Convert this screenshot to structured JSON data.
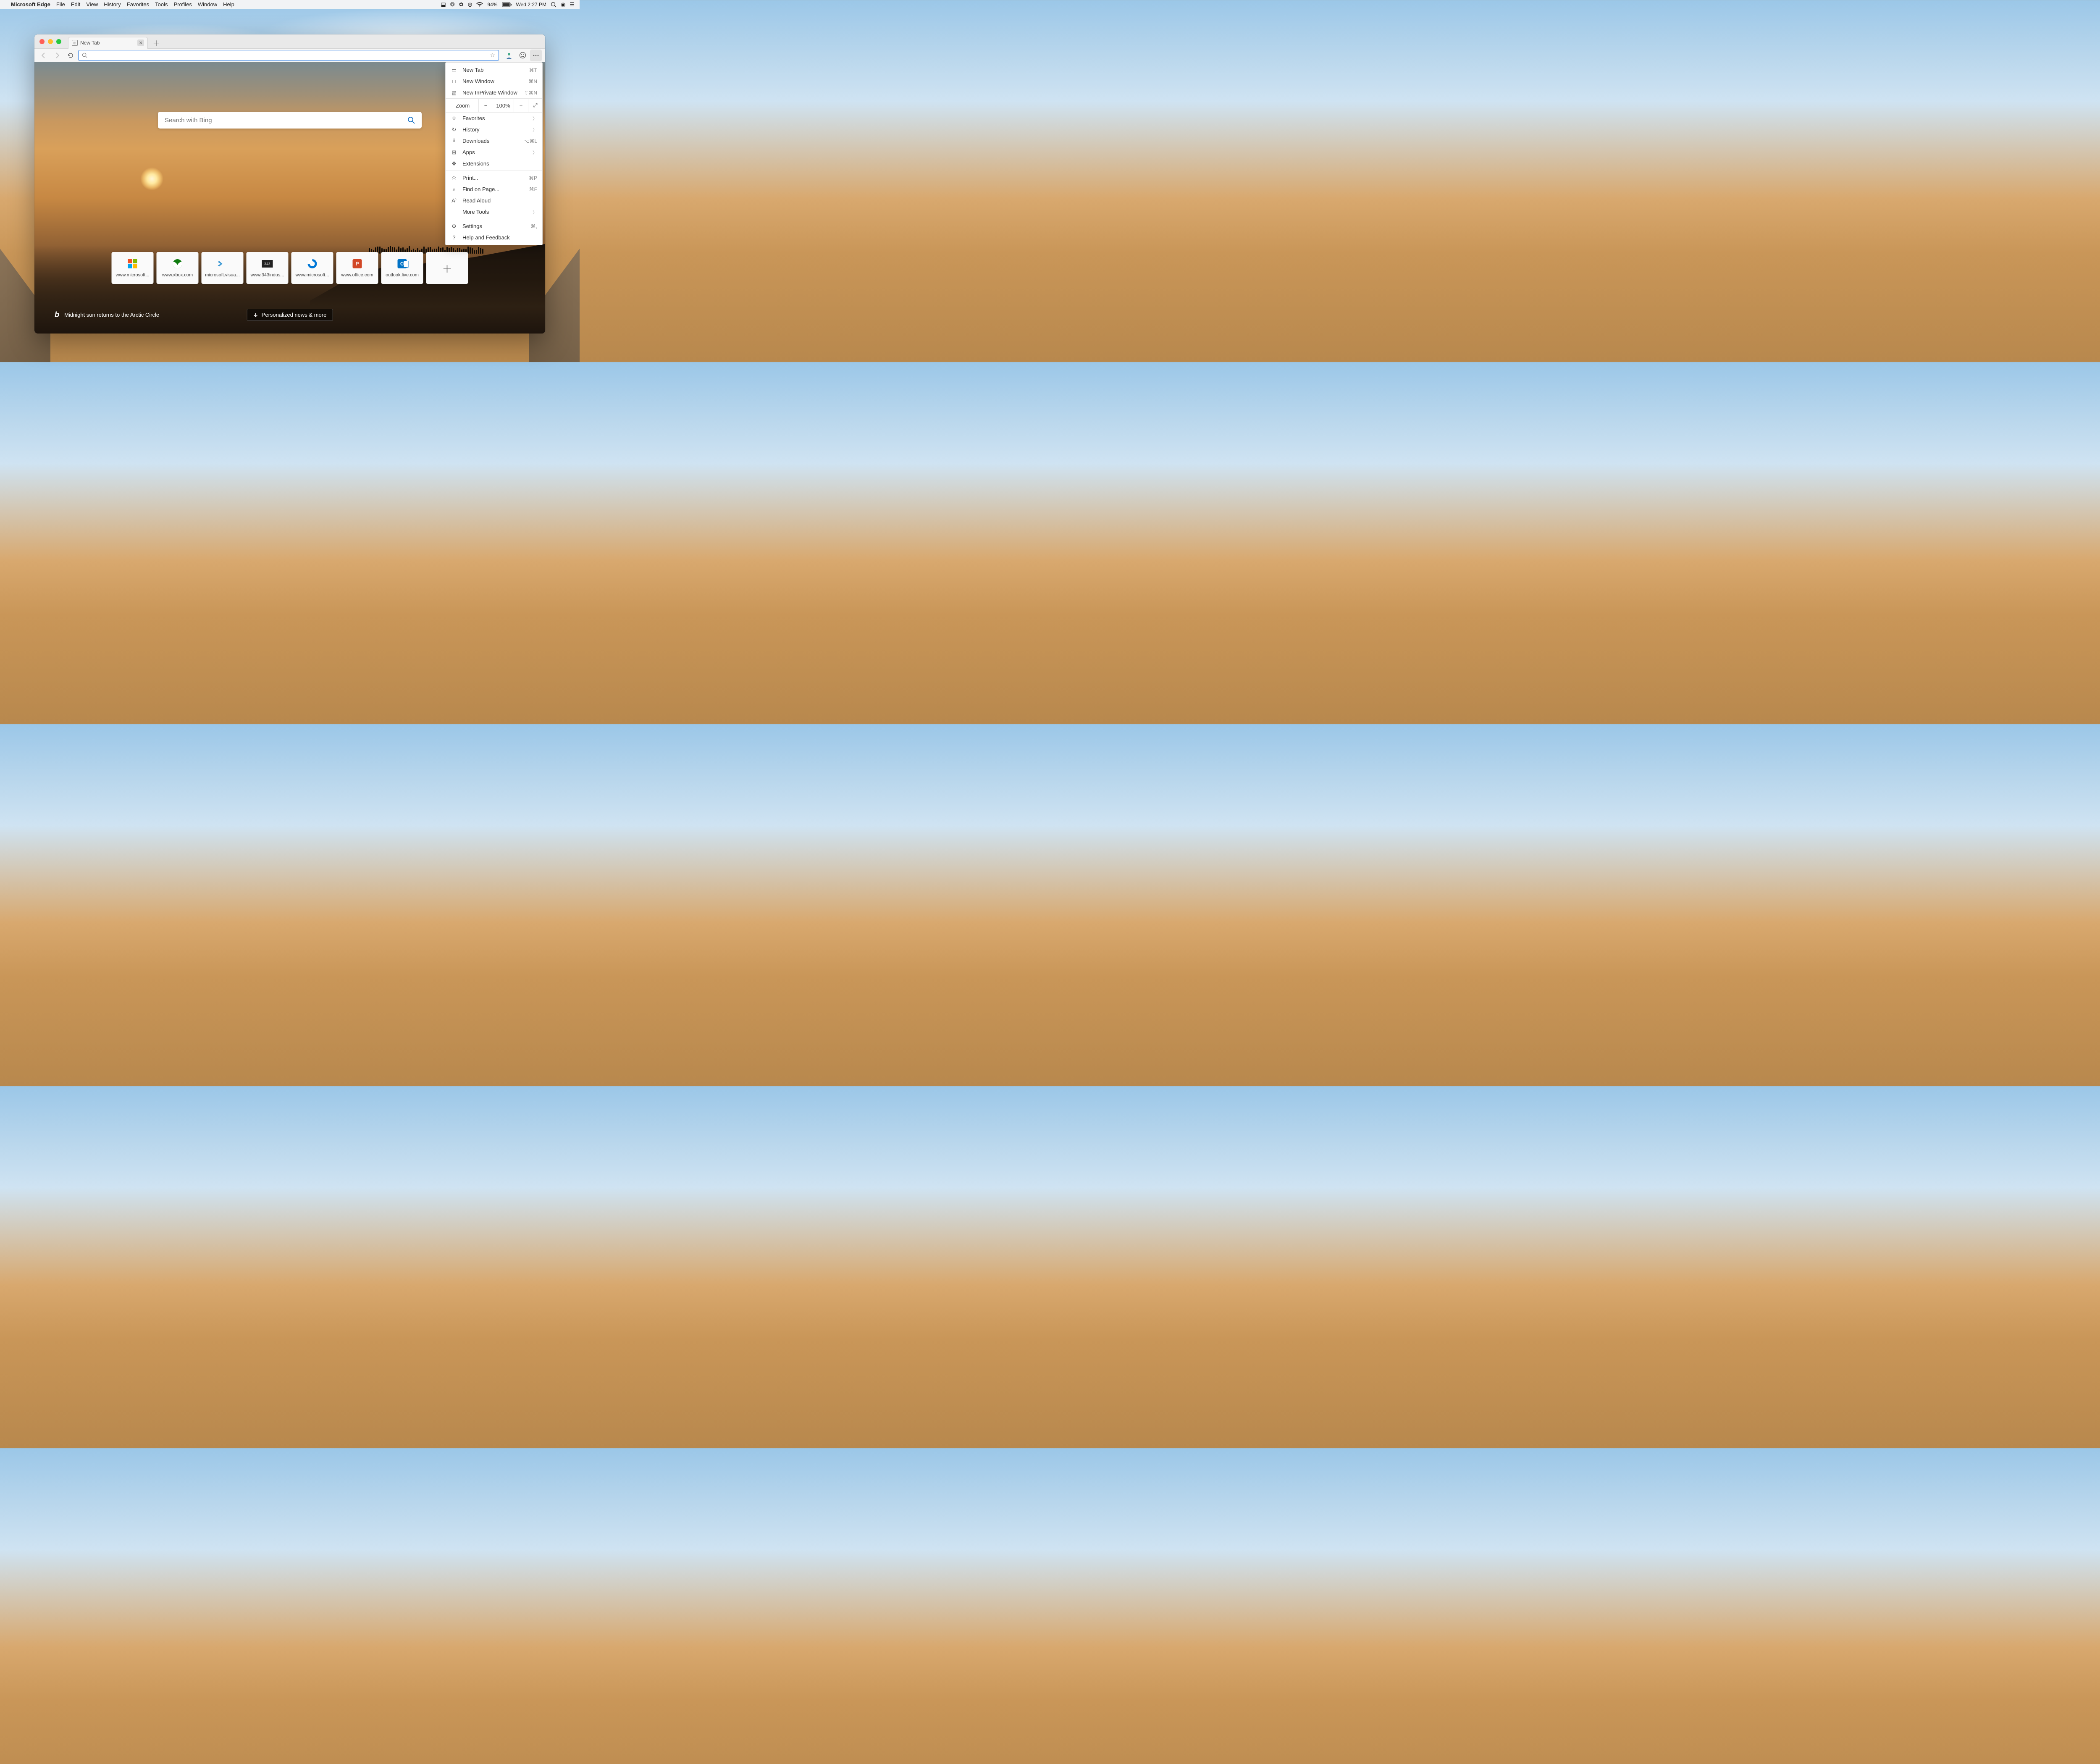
{
  "menubar": {
    "app": "Microsoft Edge",
    "items": [
      "File",
      "Edit",
      "View",
      "History",
      "Favorites",
      "Tools",
      "Profiles",
      "Window",
      "Help"
    ],
    "battery": "94%",
    "clock": "Wed 2:27 PM"
  },
  "tab": {
    "title": "New Tab"
  },
  "omnibox": {
    "placeholder": ""
  },
  "bing_search": {
    "placeholder": "Search with Bing"
  },
  "tiles": [
    {
      "label": "www.microsoft...",
      "icon": "microsoft"
    },
    {
      "label": "www.xbox.com",
      "icon": "xbox"
    },
    {
      "label": "microsoft.visua...",
      "icon": "visualstudio"
    },
    {
      "label": "www.343indus...",
      "icon": "343"
    },
    {
      "label": "www.microsoft...",
      "icon": "edge"
    },
    {
      "label": "www.office.com",
      "icon": "powerpoint"
    },
    {
      "label": "outlook.live.com",
      "icon": "outlook"
    }
  ],
  "bing_caption": "Midnight sun returns to the Arctic Circle",
  "news_button": "Personalized news & more",
  "menu": {
    "new_tab": {
      "label": "New Tab",
      "shortcut": "⌘T"
    },
    "new_window": {
      "label": "New Window",
      "shortcut": "⌘N"
    },
    "new_inprivate": {
      "label": "New InPrivate Window",
      "shortcut": "⇧⌘N"
    },
    "zoom": {
      "label": "Zoom",
      "value": "100%"
    },
    "favorites": {
      "label": "Favorites"
    },
    "history": {
      "label": "History"
    },
    "downloads": {
      "label": "Downloads",
      "shortcut": "⌥⌘L"
    },
    "apps": {
      "label": "Apps"
    },
    "extensions": {
      "label": "Extensions"
    },
    "print": {
      "label": "Print...",
      "shortcut": "⌘P"
    },
    "find": {
      "label": "Find on Page...",
      "shortcut": "⌘F"
    },
    "read_aloud": {
      "label": "Read Aloud"
    },
    "more_tools": {
      "label": "More Tools"
    },
    "settings": {
      "label": "Settings",
      "shortcut": "⌘,"
    },
    "help": {
      "label": "Help and Feedback"
    }
  }
}
